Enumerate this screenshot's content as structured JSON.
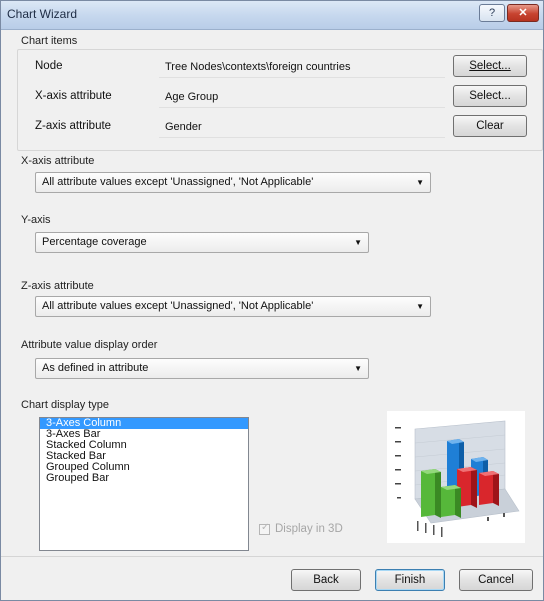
{
  "window": {
    "title": "Chart Wizard",
    "help_label": "?",
    "close_label": "✕"
  },
  "chart_items": {
    "section_label": "Chart items",
    "node_label": "Node",
    "node_value": "Tree Nodes\\contexts\\foreign countries",
    "node_button": "Select...",
    "x_label": "X-axis attribute",
    "x_value": "Age Group",
    "x_button": "Select...",
    "z_label": "Z-axis attribute",
    "z_value": "Gender",
    "z_button": "Clear"
  },
  "x_axis": {
    "label": "X-axis attribute",
    "selected": "All attribute values except 'Unassigned', 'Not Applicable'"
  },
  "y_axis": {
    "label": "Y-axis",
    "selected": "Percentage coverage"
  },
  "z_axis": {
    "label": "Z-axis attribute",
    "selected": "All attribute values except 'Unassigned', 'Not Applicable'"
  },
  "display_order": {
    "label": "Attribute value display order",
    "selected": "As defined in attribute"
  },
  "chart_type": {
    "label": "Chart display type",
    "items": [
      "3-Axes Column",
      "3-Axes Bar",
      "Stacked Column",
      "Stacked Bar",
      "Grouped Column",
      "Grouped Bar"
    ],
    "selected_index": 0,
    "display_3d_label": "Display in 3D",
    "display_3d_checked": true,
    "display_3d_enabled": false
  },
  "footer": {
    "back": "Back",
    "finish": "Finish",
    "cancel": "Cancel"
  },
  "colors": {
    "accent": "#3399ff",
    "preview_blue": "#1f7fd6",
    "preview_red": "#d9262c",
    "preview_green": "#56b83a"
  }
}
